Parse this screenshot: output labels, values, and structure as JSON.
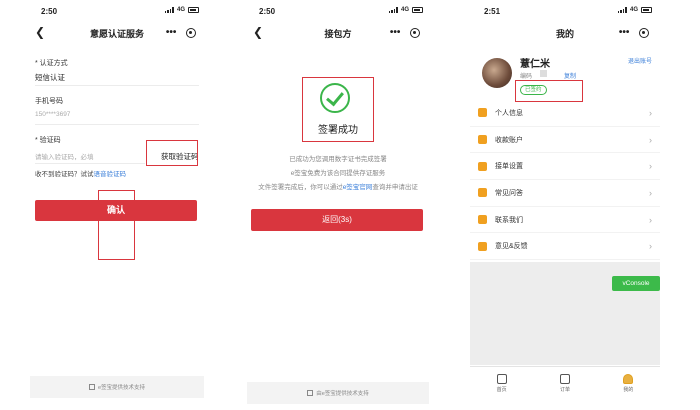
{
  "phone1": {
    "status": {
      "time": "2:50",
      "net": "4G"
    },
    "nav": {
      "title": "意愿认证服务",
      "more": "•••"
    },
    "auth_method_label": "* 认证方式",
    "auth_method_value": "短信认证",
    "phone_label": "手机号码",
    "phone_value": "150****3697",
    "code_label": "* 验证码",
    "code_placeholder": "请输入验证码，必填",
    "get_code_label": "获取验证码",
    "not_received_text": "收不到验证码？试试",
    "voice_code_link": "语音验证码",
    "confirm_label": "确认",
    "footer_text": "e签宝提供技术支持"
  },
  "phone2": {
    "status": {
      "time": "2:50",
      "net": "4G"
    },
    "nav": {
      "title": "接包方",
      "more": "•••"
    },
    "success_title": "签署成功",
    "line1": "已成功为您调用数字证书完成签署",
    "line2": "e签宝免费为该合同提供存证服务",
    "line3_prefix": "文件签署完成后，你可以通过",
    "line3_link": "e签宝官网",
    "line3_suffix": "查询并申请出证",
    "back_label": "返回(3s)",
    "footer_text": "由e签宝提供技术支持"
  },
  "phone3": {
    "status": {
      "time": "2:51",
      "net": "4G"
    },
    "nav": {
      "title": "我的",
      "more": "•••"
    },
    "user_name": "薏仁米",
    "edit_label": "编码",
    "copy_label": "复制",
    "logout_label": "退出账号",
    "auth_badge": "已签约",
    "menu": [
      {
        "label": "个人信息"
      },
      {
        "label": "收款账户"
      },
      {
        "label": "接单设置"
      },
      {
        "label": "常见问答"
      },
      {
        "label": "联系我们"
      },
      {
        "label": "意见&反馈"
      }
    ],
    "vconsole_label": "vConsole",
    "tabs": [
      {
        "label": "首页"
      },
      {
        "label": "订单"
      },
      {
        "label": "我的"
      }
    ]
  }
}
